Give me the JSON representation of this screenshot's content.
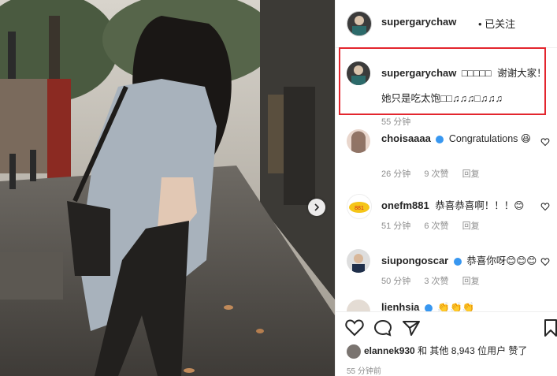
{
  "post": {
    "username": "supergarychaw",
    "follow_status": "• 已关注",
    "caption_line1": "supergarychaw",
    "caption_greeting": "□□□□□",
    "caption_thanks": "谢谢大家！",
    "caption_line2": "她只是吃太饱□□♫♫♫□♫♫♫",
    "caption_time": "55 分钟"
  },
  "comments": [
    {
      "user": "choisaaaa",
      "verified": true,
      "text": "Congratulations 😆",
      "time": "26 分钟",
      "likes": "9 次赞",
      "reply": "回复"
    },
    {
      "user": "onefm881",
      "verified": false,
      "text": "恭喜恭喜啊！！！😊",
      "time": "51 分钟",
      "likes": "6 次赞",
      "reply": "回复"
    },
    {
      "user": "siupongoscar",
      "verified": true,
      "text": "恭喜你呀😊😊😊",
      "time": "50 分钟",
      "likes": "3 次赞",
      "reply": "回复"
    },
    {
      "user": "lienhsia",
      "verified": true,
      "text": "👏👏👏",
      "time": "",
      "likes": "",
      "reply": ""
    }
  ],
  "likes_line": {
    "user": "elannek930",
    "rest": " 和 其他 8,943 位用户 赞了"
  },
  "time_ago": "55 分钟前",
  "colors": {
    "highlight": "#e3262e",
    "verified": "#3897f0",
    "meta": "#8e8e8e"
  },
  "icons": [
    "heart-icon",
    "comment-icon",
    "share-icon",
    "bookmark-icon",
    "chevron-right-icon",
    "verified-badge-icon"
  ]
}
